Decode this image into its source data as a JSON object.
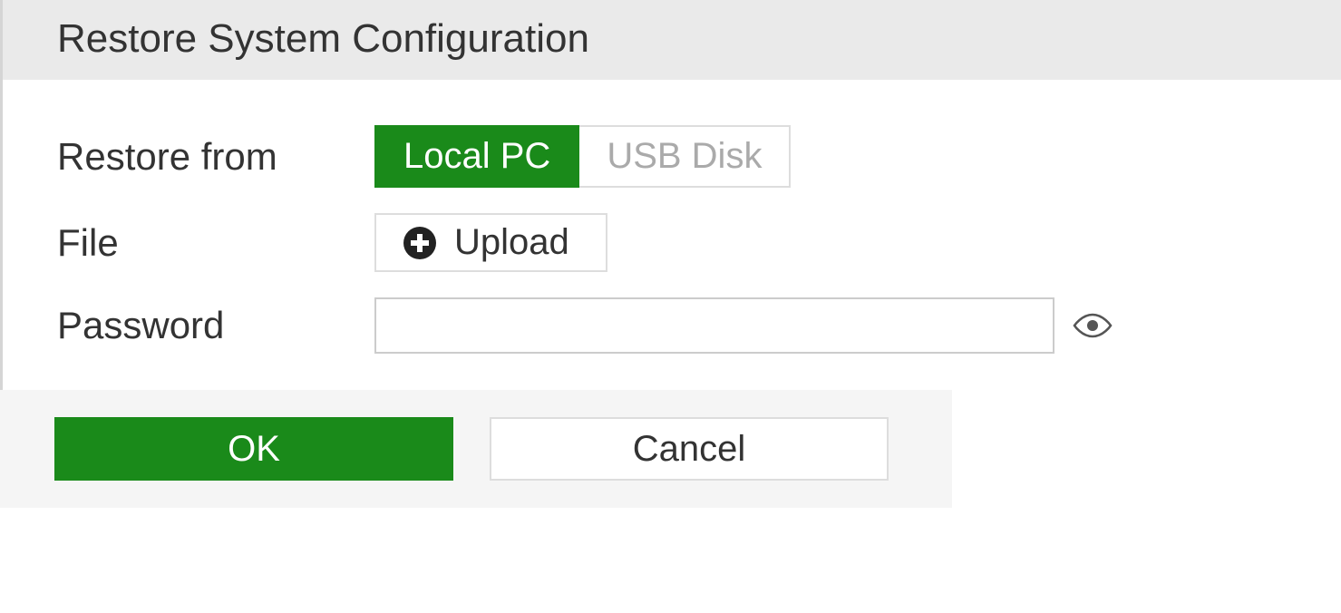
{
  "header": {
    "title": "Restore System Configuration"
  },
  "form": {
    "restore_from": {
      "label": "Restore from",
      "options": {
        "local_pc": "Local PC",
        "usb_disk": "USB Disk"
      }
    },
    "file": {
      "label": "File",
      "upload_label": "Upload"
    },
    "password": {
      "label": "Password",
      "value": ""
    }
  },
  "footer": {
    "ok_label": "OK",
    "cancel_label": "Cancel"
  }
}
